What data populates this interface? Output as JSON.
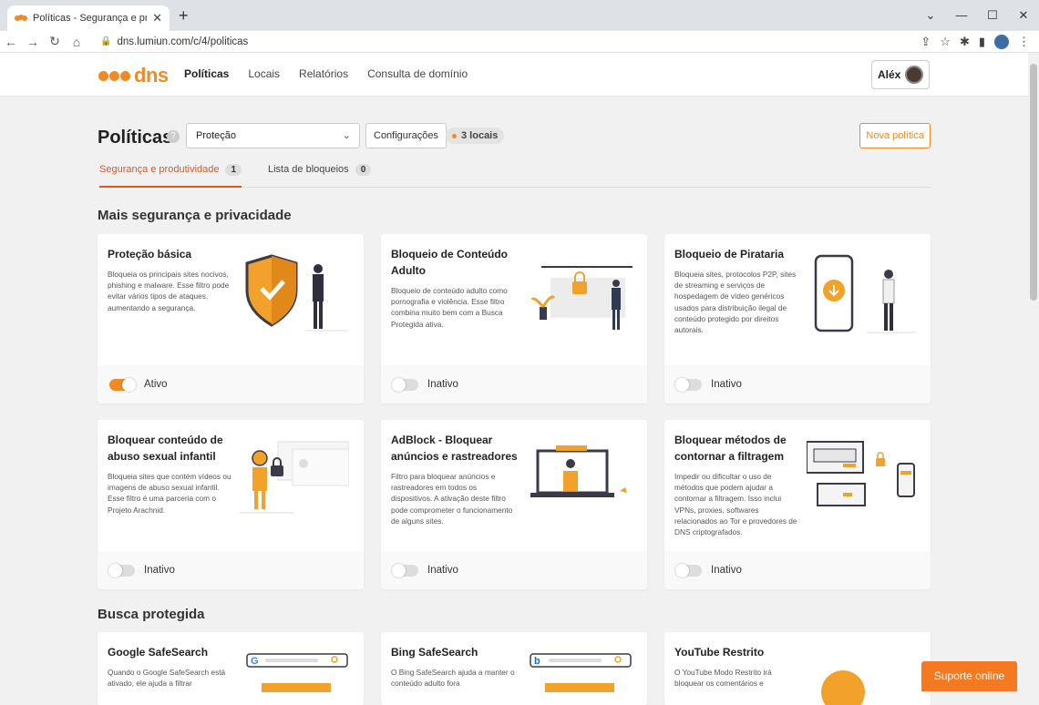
{
  "browser": {
    "tab_title": "Políticas - Segurança e produtivid",
    "url": "dns.lumiun.com/c/4/politicas"
  },
  "header": {
    "logo_text": "dns",
    "nav": [
      {
        "label": "Políticas",
        "active": true
      },
      {
        "label": "Locais"
      },
      {
        "label": "Relatórios"
      },
      {
        "label": "Consulta de domínio"
      }
    ],
    "user": "Aléx"
  },
  "page": {
    "title": "Políticas",
    "policy_select": "Proteção",
    "config_button": "Configurações",
    "locations_badge": "3 locais",
    "new_policy_button": "Nova política",
    "tabs": [
      {
        "label": "Segurança e produtividade",
        "count": "1"
      },
      {
        "label": "Lista de bloqueios",
        "count": "0"
      }
    ]
  },
  "sections": [
    {
      "title": "Mais segurança e privacidade",
      "cards": [
        {
          "title": "Proteção básica",
          "desc": "Bloqueia os principais sites nocivos, phishing e malware. Esse filtro pode evitar vários tipos de ataques, aumentando a segurança.",
          "status": "Ativo",
          "on": true
        },
        {
          "title": "Bloqueio de Conteúdo Adulto",
          "desc": "Bloqueio de conteúdo adulto como pornografia e violência. Esse filtro combina muito bem com a Busca Protegida ativa.",
          "status": "Inativo",
          "on": false
        },
        {
          "title": "Bloqueio de Pirataria",
          "desc": "Bloqueia sites, protocolos P2P, sites de streaming e serviços de hospedagem de vídeo genéricos usados para distribuição ilegal de conteúdo protegido por direitos autorais.",
          "status": "Inativo",
          "on": false
        },
        {
          "title": "Bloquear conteúdo de abuso sexual infantil",
          "desc": "Bloqueia sites que contém vídeos ou imagens de abuso sexual infantil. Esse filtro é uma parceria com o Projeto Arachnid.",
          "status": "Inativo",
          "on": false
        },
        {
          "title": "AdBlock - Bloquear anúncios e rastreadores",
          "desc": "Filtro para bloquear anúncios e rastreadores em todos os dispositivos. A ativação deste filtro pode comprometer o funcionamento de alguns sites.",
          "status": "Inativo",
          "on": false
        },
        {
          "title": "Bloquear métodos de contornar a filtragem",
          "desc": "Impedir ou dificultar o uso de métodos que podem ajudar a contornar a filtragem. Isso inclui VPNs, proxies, softwares relacionados ao Tor e provedores de DNS criptografados.",
          "status": "Inativo",
          "on": false
        }
      ]
    },
    {
      "title": "Busca protegida",
      "cards": [
        {
          "title": "Google SafeSearch",
          "desc": "Quando o Google SafeSearch está ativado, ele ajuda a filtrar"
        },
        {
          "title": "Bing SafeSearch",
          "desc": "O Bing SafeSearch ajuda a manter o conteúdo adulto fora"
        },
        {
          "title": "YouTube Restrito",
          "desc": "O YouTube Modo Restrito irá bloquear os comentários e"
        }
      ]
    }
  ],
  "support_button": "Suporte online",
  "colors": {
    "accent": "#f08a24",
    "active_tab": "#e0561f"
  }
}
